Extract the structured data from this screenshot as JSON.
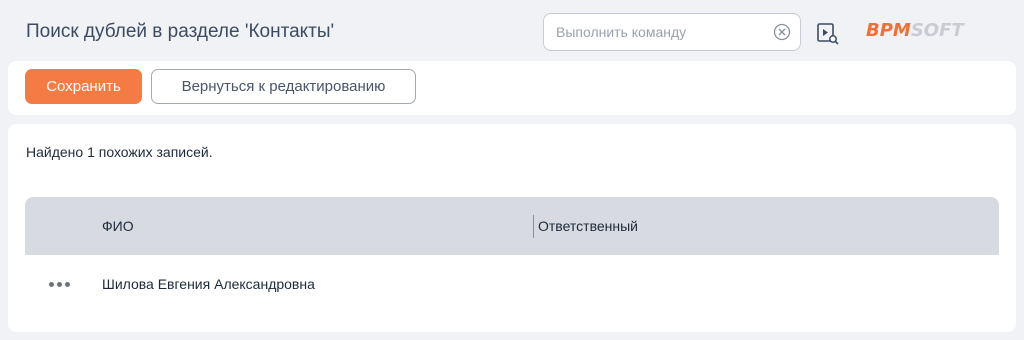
{
  "header": {
    "title": "Поиск дублей в разделе 'Контакты'",
    "command_placeholder": "Выполнить команду",
    "command_value": "",
    "logo": {
      "part_a": "BPM",
      "part_b": "SOFT",
      "accent_color": "#f26f34"
    }
  },
  "toolbar": {
    "save_label": "Сохранить",
    "back_label": "Вернуться к редактированию"
  },
  "main": {
    "found_text": "Найдено 1 похожих записей.",
    "columns": [
      "ФИО",
      "Ответственный"
    ],
    "rows": [
      {
        "name": "Шилова Евгения Александровна",
        "responsible": ""
      }
    ]
  },
  "icons": {
    "clear": "clear-icon",
    "video_search": "video-search-icon",
    "row_actions": "more-icon"
  },
  "colors": {
    "accent": "#f47b43",
    "grid_header": "#d7dae0",
    "background": "#f1f2f6"
  }
}
